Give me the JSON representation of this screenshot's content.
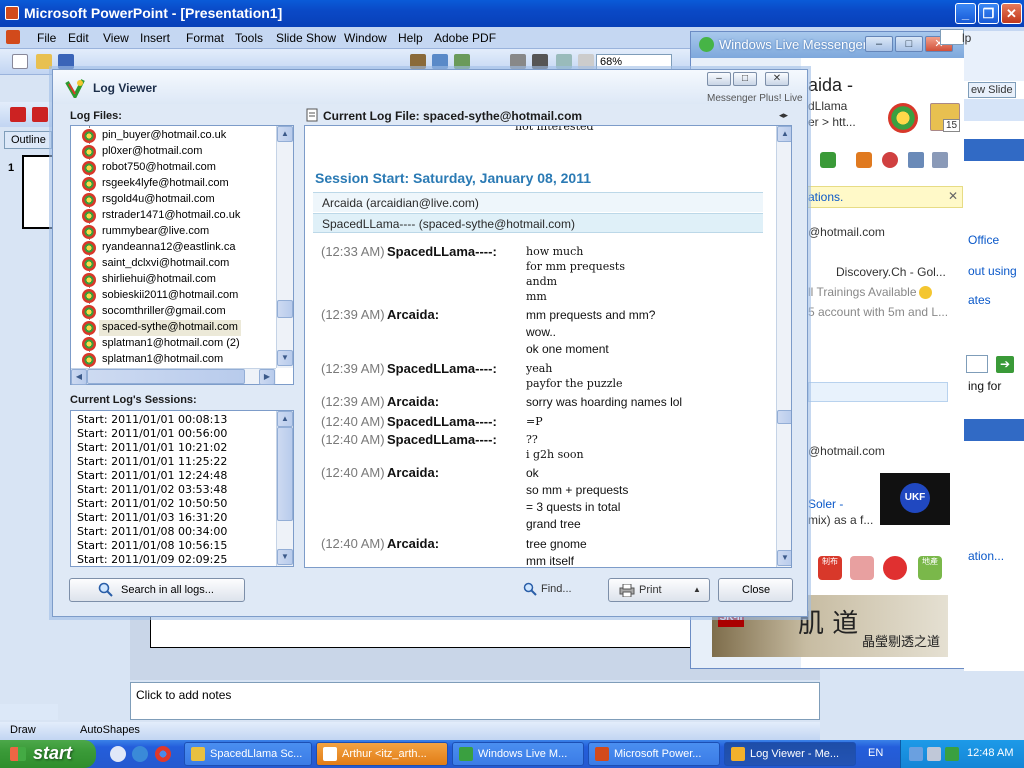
{
  "powerpoint": {
    "title": "Microsoft PowerPoint - [Presentation1]",
    "menu": [
      "File",
      "Edit",
      "View",
      "Insert",
      "Format",
      "Tools",
      "Slide Show",
      "Window",
      "Help",
      "Adobe PDF"
    ],
    "zoom": "68%",
    "outline_tab": "Outline",
    "slide_number": "1",
    "notes_placeholder": "Click to add notes",
    "draw_label": "Draw",
    "autoshapes_label": "AutoShapes",
    "new_slide": "ew Slide",
    "help_fragment": "lp"
  },
  "messenger": {
    "title": "Windows Live Messenger",
    "plus_label": "Messenger Plus! Live",
    "name_fragment": "aida -",
    "status_fragment_1": "dLlama",
    "status_fragment_2": "er > htt...",
    "badge": "15",
    "notice": "ations.",
    "email": "@hotmail.com",
    "news_1": "Discovery.Ch - Gol...",
    "news_2": "ll Trainings Available",
    "news_3": "5 account with 5m and L...",
    "email_2": "@hotmail.com",
    "ad_text_1": "Soler -",
    "ad_text_2": "mix) as a f...",
    "ad_logo": "UKF",
    "ad2_brand": "SK-II",
    "ad2_cn_1": "肌 道",
    "ad2_cn_2": "晶瑩剔透之道",
    "cn_icon_1": "制布",
    "cn_icon_2": "地產",
    "right_fragments": [
      "Office",
      "out using",
      "ates",
      "ing for",
      "ation..."
    ]
  },
  "logviewer": {
    "title": "Log Viewer",
    "plus_label": "Messenger Plus! Live",
    "log_files_label": "Log Files:",
    "files": [
      {
        "name": "pin_buyer@hotmail.co.uk",
        "selected": false
      },
      {
        "name": "pl0xer@hotmail.com",
        "selected": false
      },
      {
        "name": "robot750@hotmail.com",
        "selected": false
      },
      {
        "name": "rsgeek4lyfe@hotmail.com",
        "selected": false
      },
      {
        "name": "rsgold4u@hotmail.com",
        "selected": false
      },
      {
        "name": "rstrader1471@hotmail.co.uk",
        "selected": false
      },
      {
        "name": "rummybear@live.com",
        "selected": false
      },
      {
        "name": "ryandeanna12@eastlink.ca",
        "selected": false
      },
      {
        "name": "saint_dclxvi@hotmail.com",
        "selected": false
      },
      {
        "name": "shirliehui@hotmail.com",
        "selected": false
      },
      {
        "name": "sobieskii2011@hotmail.com",
        "selected": false
      },
      {
        "name": "socomthriller@gmail.com",
        "selected": false
      },
      {
        "name": "spaced-sythe@hotmail.com",
        "selected": true
      },
      {
        "name": "splatman1@hotmail.com (2)",
        "selected": false
      },
      {
        "name": "splatman1@hotmail.com",
        "selected": false
      }
    ],
    "sessions_label": "Current Log's Sessions:",
    "sessions": [
      "Start: 2011/01/01 00:08:13",
      "Start: 2011/01/01 00:56:00",
      "Start: 2011/01/01 10:21:02",
      "Start: 2011/01/01 11:25:22",
      "Start: 2011/01/01 12:24:48",
      "Start: 2011/01/02 03:53:48",
      "Start: 2011/01/02 10:50:50",
      "Start: 2011/01/03 16:31:20",
      "Start: 2011/01/08 00:34:00",
      "Start: 2011/01/08 10:56:15",
      "Start: 2011/01/09 02:09:25"
    ],
    "current_log_label": "Current Log File: spaced-sythe@hotmail.com",
    "top_cutoff": "not interested",
    "session_head": "Session Start: Saturday, January 08, 2011",
    "participants": [
      "Arcaida (arcaidian@live.com)",
      "SpacedLLama---- (spaced-sythe@hotmail.com)"
    ],
    "messages": [
      {
        "time": "(12:33 AM)",
        "nick": "SpacedLLama----:",
        "lines": [
          "how much",
          "for mm prequests",
          "andm",
          "mm"
        ],
        "serif": true
      },
      {
        "time": "(12:39 AM)",
        "nick": "Arcaida:",
        "lines": [
          "mm prequests and mm?",
          "wow..",
          "ok one moment"
        ],
        "serif": false
      },
      {
        "time": "(12:39 AM)",
        "nick": "SpacedLLama----:",
        "lines": [
          "yeah",
          "payfor the puzzle"
        ],
        "serif": true
      },
      {
        "time": "(12:39 AM)",
        "nick": "Arcaida:",
        "lines": [
          "sorry was hoarding names lol"
        ],
        "serif": false
      },
      {
        "time": "(12:40 AM)",
        "nick": "SpacedLLama----:",
        "lines": [
          "=P"
        ],
        "serif": true
      },
      {
        "time": "(12:40 AM)",
        "nick": "SpacedLLama----:",
        "lines": [
          "??",
          "i g2h soon"
        ],
        "serif": true
      },
      {
        "time": "(12:40 AM)",
        "nick": "Arcaida:",
        "lines": [
          "ok",
          "so mm + prequests",
          "= 3 quests in total",
          "grand tree"
        ],
        "serif": false
      },
      {
        "time": "(12:40 AM)",
        "nick": "Arcaida:",
        "lines": [
          "tree gnome",
          "mm itself"
        ],
        "serif": false
      }
    ],
    "search_button": "Search in all logs...",
    "find_button": "Find...",
    "print_button": "Print",
    "close_button": "Close"
  },
  "taskbar": {
    "start": "start",
    "tasks": [
      {
        "label": "SpacedLlama Sc...",
        "style": "normal",
        "icon_color": "#e8c040"
      },
      {
        "label": "Arthur <itz_arth...",
        "style": "orange",
        "icon_color": "#ffffff"
      },
      {
        "label": "Windows Live M...",
        "style": "normal",
        "icon_color": "#3aa040"
      },
      {
        "label": "Microsoft Power...",
        "style": "normal",
        "icon_color": "#d24a1b"
      },
      {
        "label": "Log Viewer - Me...",
        "style": "active",
        "icon_color": "#f2b12c"
      }
    ],
    "language": "EN",
    "clock": "12:48 AM"
  }
}
